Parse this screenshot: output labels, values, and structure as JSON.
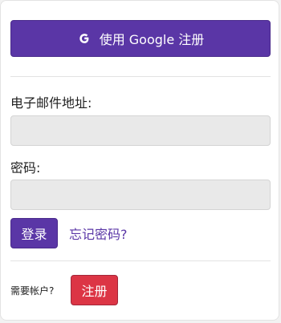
{
  "google_signup": {
    "label": "使用 Google 注册",
    "icon": "google-icon"
  },
  "form": {
    "email_label": "电子邮件地址:",
    "email_value": "",
    "password_label": "密码:",
    "password_value": ""
  },
  "actions": {
    "login_label": "登录",
    "forgot_password_label": "忘记密码?"
  },
  "footer": {
    "need_account_label": "需要帐户?",
    "register_label": "注册"
  },
  "colors": {
    "primary": "#5a36a6",
    "danger": "#dc3545",
    "input_bg": "#e9e9e9"
  }
}
